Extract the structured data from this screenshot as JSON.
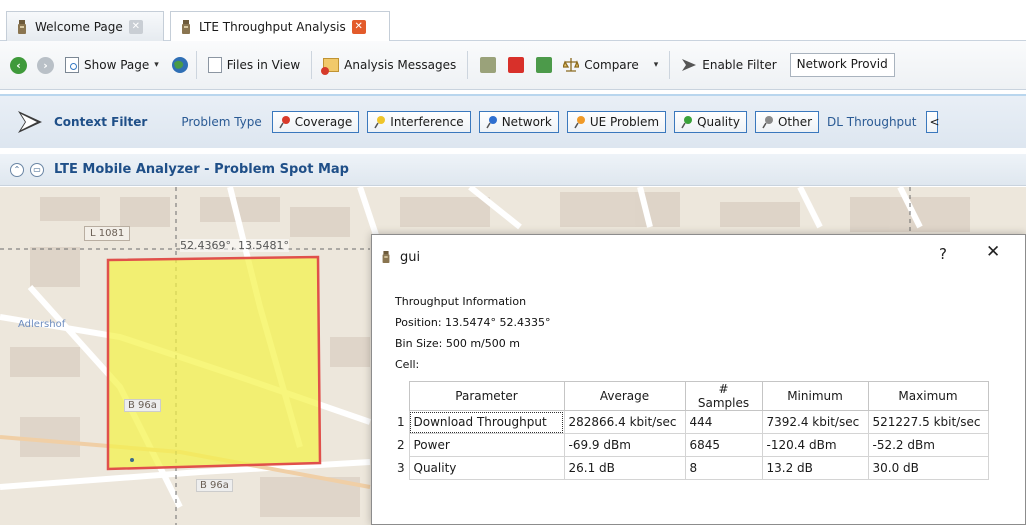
{
  "tabs": [
    {
      "label": "Welcome Page",
      "active": false
    },
    {
      "label": "LTE Throughput Analysis",
      "active": true
    }
  ],
  "toolbar": {
    "show_page": "Show Page",
    "files_in_view": "Files in View",
    "analysis_messages": "Analysis Messages",
    "compare": "Compare",
    "enable_filter": "Enable Filter",
    "network_provider": "Network Provid"
  },
  "filter": {
    "title": "Context Filter",
    "problem_type_label": "Problem Type",
    "buttons": [
      "Coverage",
      "Interference",
      "Network",
      "UE Problem",
      "Quality",
      "Other"
    ],
    "dl_throughput_label": "DL Throughput"
  },
  "panel": {
    "title": "LTE Mobile Analyzer - Problem Spot Map"
  },
  "map": {
    "road_label": "L 1081",
    "coordinate": "52.4369°, 13.5481°",
    "b96a": "B 96a",
    "district": "Adlershof",
    "highlight_color": "#f4f24a",
    "highlight_border": "#e0504b"
  },
  "dialog": {
    "title": "gui",
    "help": "?",
    "close": "✕",
    "info_title": "Throughput Information",
    "position": "Position: 13.5474° 52.4335°",
    "bin_size": "Bin Size: 500 m/500 m",
    "cell": "Cell:",
    "columns": [
      "Parameter",
      "Average",
      "# Samples",
      "Minimum",
      "Maximum"
    ],
    "rows": [
      {
        "num": "1",
        "parameter": "Download Throughput",
        "average": "282866.4 kbit/sec",
        "samples": "444",
        "minimum": "7392.4 kbit/sec",
        "maximum": "521227.5 kbit/sec"
      },
      {
        "num": "2",
        "parameter": "Power",
        "average": "-69.9 dBm",
        "samples": "6845",
        "minimum": "-120.4 dBm",
        "maximum": "-52.2 dBm"
      },
      {
        "num": "3",
        "parameter": "Quality",
        "average": "26.1 dB",
        "samples": "8",
        "minimum": "13.2 dB",
        "maximum": "30.0 dB"
      }
    ]
  }
}
